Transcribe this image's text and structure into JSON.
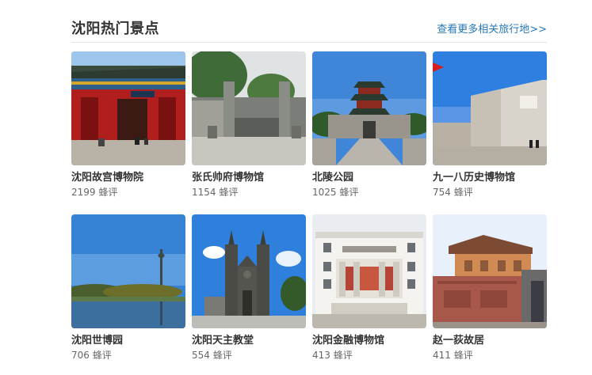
{
  "section": {
    "title": "沈阳热门景点",
    "more_link": "查看更多相关旅行地>>"
  },
  "colors": {
    "link": "#2577b7",
    "title": "#333333",
    "meta": "#666666"
  },
  "attractions": [
    {
      "name": "沈阳故宫博物院",
      "count": "2199",
      "unit": "蜂评",
      "image": "palace-photo"
    },
    {
      "name": "张氏帅府博物馆",
      "count": "1154",
      "unit": "蜂评",
      "image": "mansion-gate-photo"
    },
    {
      "name": "北陵公园",
      "count": "1025",
      "unit": "蜂评",
      "image": "tomb-tower-photo"
    },
    {
      "name": "九一八历史博物馆",
      "count": "754",
      "unit": "蜂评",
      "image": "memorial-monument-photo"
    },
    {
      "name": "沈阳世博园",
      "count": "706",
      "unit": "蜂评",
      "image": "lake-tower-photo"
    },
    {
      "name": "沈阳天主教堂",
      "count": "554",
      "unit": "蜂评",
      "image": "cathedral-photo"
    },
    {
      "name": "沈阳金融博物馆",
      "count": "413",
      "unit": "蜂评",
      "image": "bank-building-photo"
    },
    {
      "name": "赵一荻故居",
      "count": "411",
      "unit": "蜂评",
      "image": "residence-photo"
    }
  ]
}
